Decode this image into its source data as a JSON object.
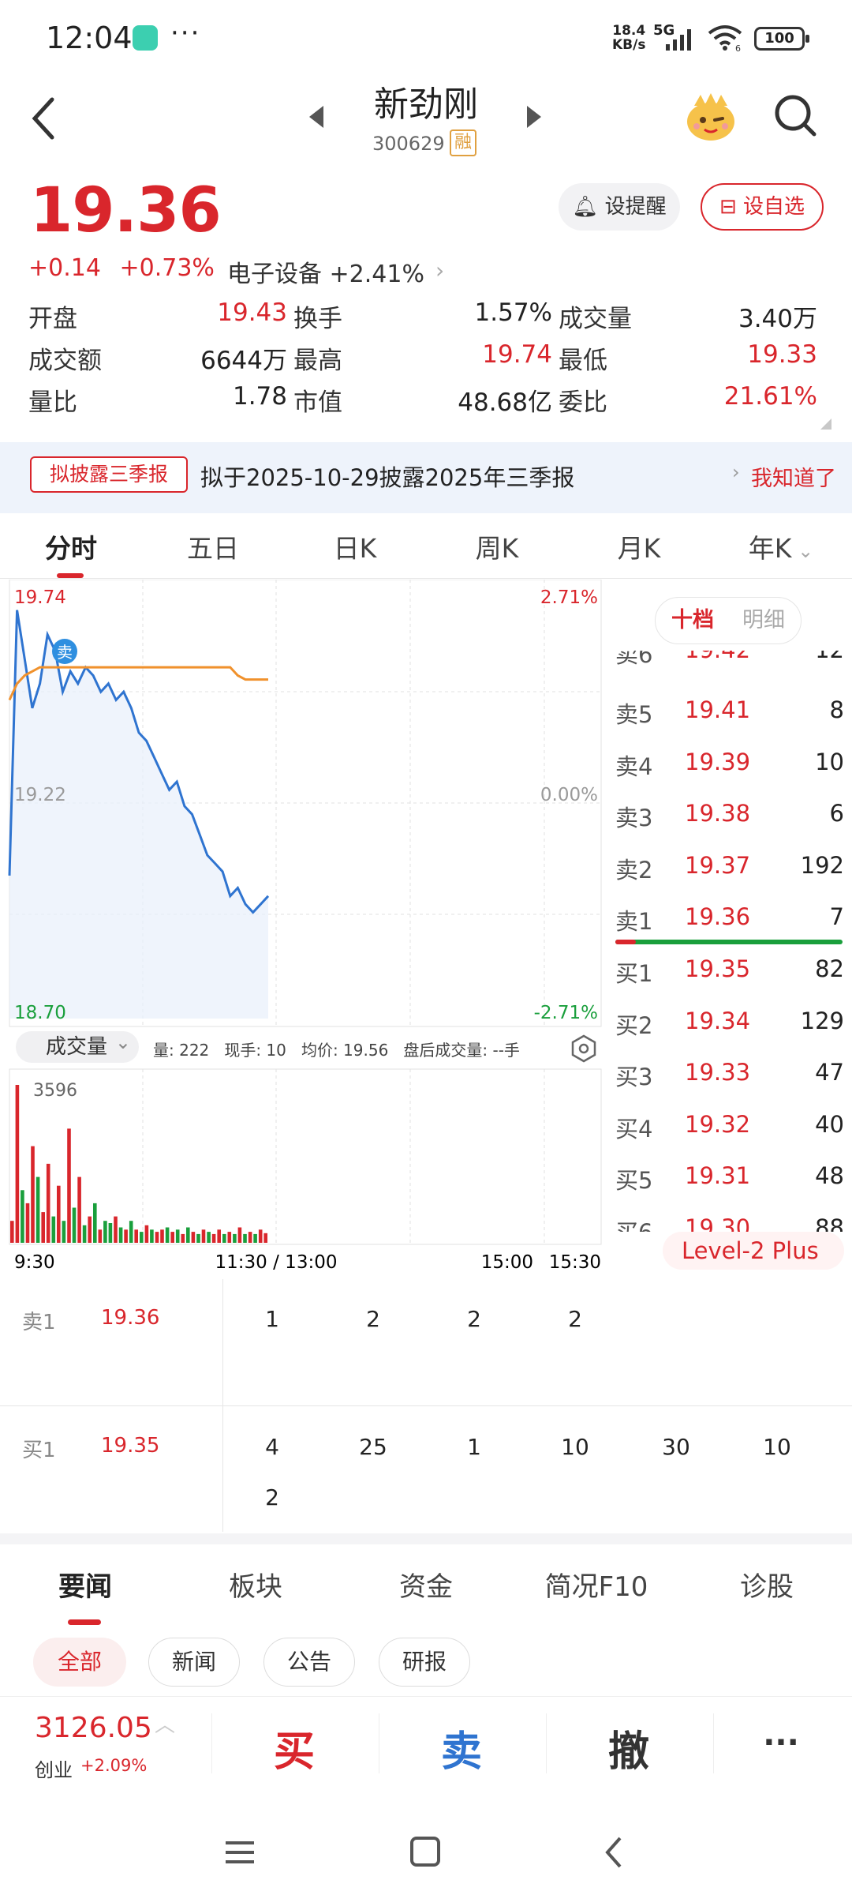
{
  "status_bar": {
    "time": "12:04",
    "more": "···",
    "net_speed_top": "18.4",
    "net_speed_bottom": "KB/s",
    "network": "5G",
    "wifi_sub": "6",
    "battery": "100"
  },
  "header": {
    "stock_name": "新劲刚",
    "stock_code": "300629",
    "margin_badge": "融"
  },
  "quote": {
    "price": "19.36",
    "change": "+0.14",
    "change_pct": "+0.73%",
    "sector": "电子设备 +2.41%",
    "alert_btn": "设提醒",
    "fav_btn": "设自选",
    "stats": [
      [
        {
          "label": "开盘",
          "value": "19.43",
          "red": true
        },
        {
          "label": "换手",
          "value": "1.57%",
          "red": false
        },
        {
          "label": "成交量",
          "value": "3.40万",
          "red": false
        }
      ],
      [
        {
          "label": "成交额",
          "value": "6644万",
          "red": false
        },
        {
          "label": "最高",
          "value": "19.74",
          "red": true
        },
        {
          "label": "最低",
          "value": "19.33",
          "red": true
        }
      ],
      [
        {
          "label": "量比",
          "value": "1.78",
          "red": false
        },
        {
          "label": "市值",
          "value": "48.68亿",
          "red": false
        },
        {
          "label": "委比",
          "value": "21.61%",
          "red": true
        }
      ]
    ]
  },
  "notice": {
    "tag": "拟披露三季报",
    "text": "拟于2025-10-29披露2025年三季报",
    "dismiss": "我知道了"
  },
  "chart_tabs": [
    "分时",
    "五日",
    "日K",
    "周K",
    "月K",
    "年K"
  ],
  "chart": {
    "y_top": "19.74",
    "y_mid": "19.22",
    "y_bot": "18.70",
    "pct_top": "2.71%",
    "pct_mid": "0.00%",
    "pct_bot": "-2.71%",
    "sell_marker": "卖",
    "vol_select": "成交量",
    "vol_info": "量: 222   现手: 10   均价: 19.56   盘后成交量: --手",
    "vol_max": "3596",
    "times": [
      "9:30",
      "11:30 / 13:00",
      "15:00",
      "15:30"
    ]
  },
  "chart_data": {
    "type": "line",
    "title": "",
    "ylim": [
      18.7,
      19.74
    ],
    "series": [
      {
        "name": "",
        "values": [
          19.05,
          19.7,
          19.58,
          19.46,
          19.52,
          19.64,
          19.6,
          19.5,
          19.55,
          19.52,
          19.56,
          19.54,
          19.5,
          19.52,
          19.48,
          19.5,
          19.46,
          19.4,
          19.38,
          19.34,
          19.3,
          19.26,
          19.28,
          19.22,
          19.2,
          19.15,
          19.1,
          19.08,
          19.06,
          19.0,
          19.02,
          18.98,
          18.96,
          18.98,
          19.0
        ]
      },
      {
        "name": "",
        "values": [
          19.48,
          19.52,
          19.54,
          19.55,
          19.56,
          19.56,
          19.56,
          19.56,
          19.56,
          19.56,
          19.56,
          19.56,
          19.56,
          19.56,
          19.56,
          19.56,
          19.56,
          19.56,
          19.56,
          19.56,
          19.56,
          19.56,
          19.56,
          19.56,
          19.56,
          19.56,
          19.56,
          19.56,
          19.56,
          19.56,
          19.54,
          19.53,
          19.53,
          19.53,
          19.53
        ]
      }
    ],
    "volume": {
      "max": 3596,
      "values": [
        500,
        3596,
        1200,
        900,
        2200,
        1500,
        700,
        1800,
        600,
        1300,
        500,
        2600,
        800,
        1500,
        400,
        600,
        900,
        300,
        500,
        450,
        600,
        350,
        300,
        500,
        300,
        250,
        400,
        300,
        250,
        300,
        350,
        250,
        300,
        200,
        350,
        250,
        200,
        300,
        250,
        200,
        300,
        200,
        250,
        200,
        350,
        200,
        250,
        200,
        300,
        220
      ],
      "up": [
        false,
        false,
        true,
        false,
        false,
        true,
        false,
        false,
        true,
        false,
        true,
        false,
        true,
        false,
        true,
        false,
        true,
        false,
        true,
        true,
        false,
        true,
        false,
        true,
        false,
        true,
        false,
        true,
        false,
        false,
        true,
        false,
        true,
        false,
        true,
        false,
        true,
        false,
        true,
        false,
        false,
        true,
        false,
        true,
        false,
        true,
        false,
        true,
        false,
        false
      ]
    }
  },
  "order_book": {
    "tab_active": "十档",
    "tab_other": "明细",
    "asks": [
      {
        "label": "卖5",
        "price": "19.41",
        "qty": "8"
      },
      {
        "label": "卖4",
        "price": "19.39",
        "qty": "10"
      },
      {
        "label": "卖3",
        "price": "19.38",
        "qty": "6"
      },
      {
        "label": "卖2",
        "price": "19.37",
        "qty": "192"
      },
      {
        "label": "卖1",
        "price": "19.36",
        "qty": "7"
      }
    ],
    "bids": [
      {
        "label": "买1",
        "price": "19.35",
        "qty": "82"
      },
      {
        "label": "买2",
        "price": "19.34",
        "qty": "129"
      },
      {
        "label": "买3",
        "price": "19.33",
        "qty": "47"
      },
      {
        "label": "买4",
        "price": "19.32",
        "qty": "40"
      },
      {
        "label": "买5",
        "price": "19.31",
        "qty": "48"
      }
    ],
    "level2": "Level-2 Plus"
  },
  "queue": {
    "sell_label": "卖1",
    "sell_price": "19.36",
    "sell_orders": [
      "1",
      "2",
      "2",
      "2"
    ],
    "buy_label": "买1",
    "buy_price": "19.35",
    "buy_orders_row1": [
      "4",
      "25",
      "1",
      "10",
      "30",
      "10"
    ],
    "buy_orders_row2": [
      "2"
    ]
  },
  "news_tabs": [
    "要闻",
    "板块",
    "资金",
    "简况F10",
    "诊股"
  ],
  "news_chips": [
    "全部",
    "新闻",
    "公告",
    "研报"
  ],
  "bottom_bar": {
    "index_value": "3126.05",
    "index_name": "创业",
    "index_change": "+2.09%",
    "buy": "买",
    "sell": "卖",
    "cancel": "撤",
    "more": "···"
  },
  "colors": {
    "up_red": "#d9262c",
    "down_green": "#1a9f3c",
    "price_line": "#2f74d0",
    "avg_line": "#f0912c"
  }
}
